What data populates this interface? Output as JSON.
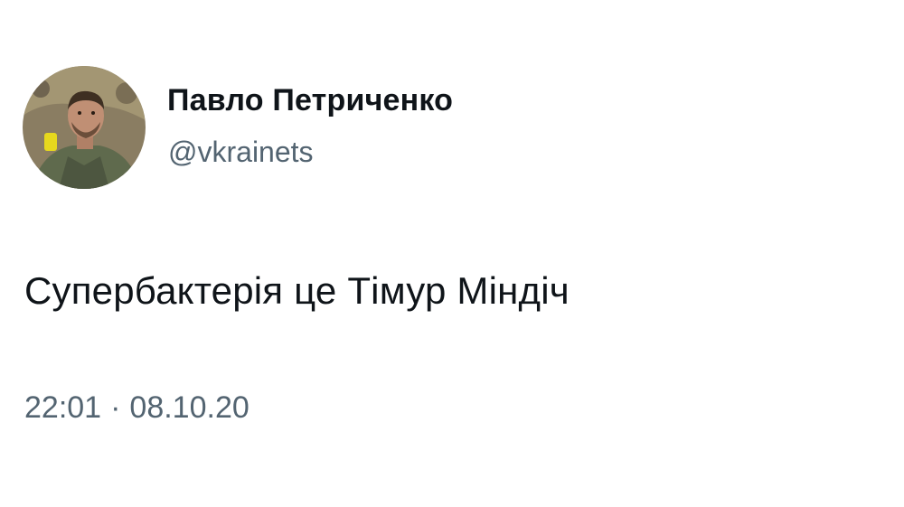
{
  "tweet": {
    "author": {
      "display_name": "Павло Петриченко",
      "handle": "@vkrainets",
      "avatar_icon": "user-avatar-photo"
    },
    "text": "Супербактерія це Тімур Міндіч",
    "time": "22:01",
    "separator": "·",
    "date": "08.10.20"
  },
  "colors": {
    "text_primary": "#0f1419",
    "text_secondary": "#536471",
    "background": "#ffffff"
  }
}
